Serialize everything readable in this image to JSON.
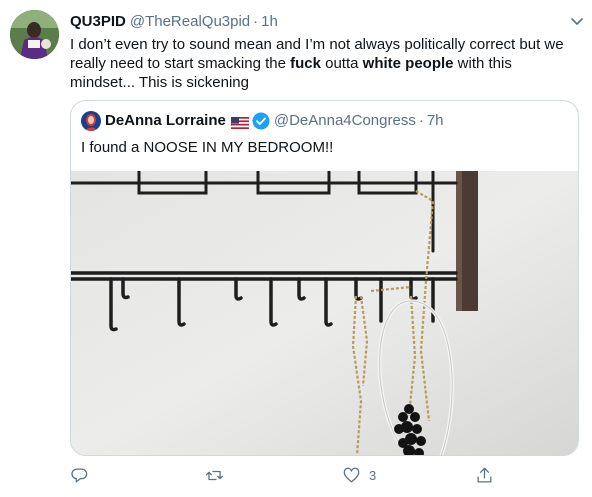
{
  "tweet": {
    "author_name": "QU3PID",
    "author_handle": "@TheRealQu3pid",
    "separator": "·",
    "time": "1h",
    "text_1": "I don’t even try to sound mean and I’m not always politically correct but we really need to start smacking the ",
    "text_bold_1": "fuck",
    "text_2": " outta ",
    "text_bold_2": "white people",
    "text_3": " with this mindset... This is sickening"
  },
  "quoted": {
    "author_name": "DeAnna Lorraine",
    "author_handle": "@DeAnna4Congress",
    "separator": "·",
    "time": "7h",
    "text": "I found a NOOSE IN MY BEDROOM!!"
  },
  "actions": {
    "reply_count": "",
    "retweet_count": "",
    "like_count": "3",
    "share_count": ""
  },
  "colors": {
    "text": "#0f1419",
    "secondary": "#5b7083",
    "border": "#cfd9de",
    "verified": "#1da1f2"
  }
}
